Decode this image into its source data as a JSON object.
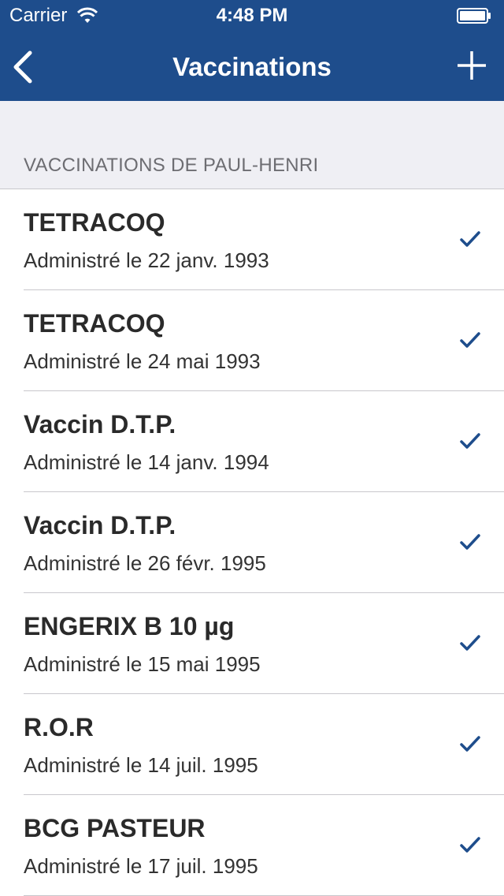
{
  "status_bar": {
    "carrier": "Carrier",
    "time": "4:48 PM"
  },
  "nav": {
    "title": "Vaccinations",
    "back_icon": "chevron-left-icon",
    "add_icon": "plus-icon"
  },
  "section": {
    "header": "VACCINATIONS DE PAUL-HENRI"
  },
  "vaccinations": [
    {
      "name": "TETRACOQ",
      "date": "Administré le 22 janv. 1993",
      "checked": true
    },
    {
      "name": "TETRACOQ",
      "date": "Administré le 24 mai 1993",
      "checked": true
    },
    {
      "name": "Vaccin D.T.P.",
      "date": "Administré le 14 janv. 1994",
      "checked": true
    },
    {
      "name": "Vaccin D.T.P.",
      "date": "Administré le 26 févr. 1995",
      "checked": true
    },
    {
      "name": "ENGERIX B 10 µg",
      "date": "Administré le 15 mai 1995",
      "checked": true
    },
    {
      "name": "R.O.R",
      "date": "Administré le 14 juil. 1995",
      "checked": true
    },
    {
      "name": "BCG PASTEUR",
      "date": "Administré le 17 juil. 1995",
      "checked": true
    }
  ],
  "colors": {
    "nav_background": "#1e4d8c",
    "accent": "#1e4d8c",
    "page_background": "#efeff4"
  }
}
